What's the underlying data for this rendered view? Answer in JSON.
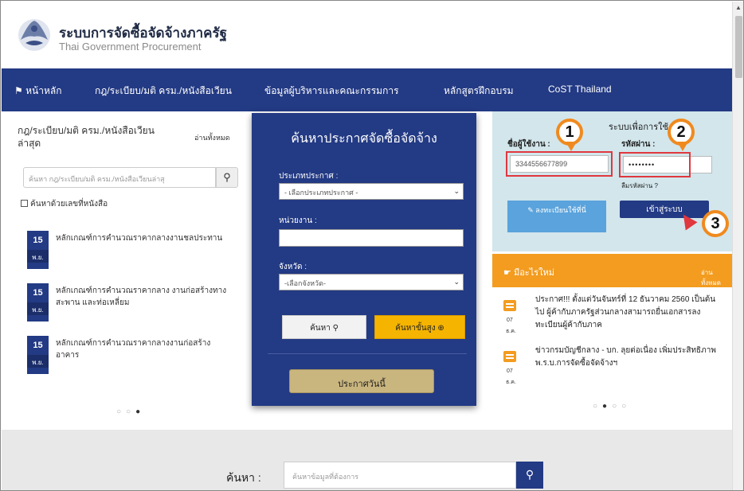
{
  "header": {
    "title": "ระบบการจัดซื้อจัดจ้างภาครัฐ",
    "subtitle": "Thai Government Procurement"
  },
  "nav": {
    "items": [
      {
        "label": "หน้าหลัก"
      },
      {
        "label": "กฎ/ระเบียบ/มติ ครม./หนังสือเวียน"
      },
      {
        "label": "ข้อมูลผู้บริหารและคณะกรรมการ"
      },
      {
        "label": "หลักสูตรฝึกอบรม"
      },
      {
        "label": "CoST Thailand"
      }
    ]
  },
  "left": {
    "title": "กฎ/ระเบียบ/มติ ครม./หนังสือเวียนล่าสุด",
    "read_all": "อ่านทั้งหมด",
    "search_placeholder": "ค้นหา กฎ/ระเบียบ/มติ ครม./หนังสือเวียนล่าสุ",
    "checkbox_label": "ค้นหาด้วยเลขที่หนังสือ",
    "items": [
      {
        "day": "15",
        "month": "พ.ย.",
        "text": "หลักเกณฑ์การคำนวณราคากลางงานชลประทาน"
      },
      {
        "day": "15",
        "month": "พ.ย.",
        "text": "หลักเกณฑ์การคำนวณราคากลาง งานก่อสร้างทาง สะพาน และท่อเหลี่ยม"
      },
      {
        "day": "15",
        "month": "พ.ย.",
        "text": "หลักเกณฑ์การคำนวณราคากลางงานก่อสร้างอาคาร"
      }
    ]
  },
  "center": {
    "title": "ค้นหาประกาศจัดซื้อจัดจ้าง",
    "type_label": "ประเภทประกาศ :",
    "type_value": "- เลือกประเภทประกาศ -",
    "agency_label": "หน่วยงาน :",
    "province_label": "จังหวัด :",
    "province_value": "-เลือกจังหวัด-",
    "search_button": "ค้นหา",
    "advanced_button": "ค้นหาขั้นสูง",
    "today_button": "ประกาศวันนี้"
  },
  "login": {
    "title": "ระบบเพื่อการใช้งาน",
    "username_label": "ชื่อผู้ใช้งาน :",
    "username_value": "3344556677899",
    "password_label": "รหัสผ่าน :",
    "password_value": "••••••••",
    "forgot": "ลืมรหัสผ่าน ?",
    "register_button": "ลงทะเบียนใช้ที่นี่",
    "login_button": "เข้าสู่ระบบ",
    "markers": [
      "1",
      "2",
      "3"
    ]
  },
  "whatsnew": {
    "title": "มีอะไรใหม่",
    "read_all": "อ่านทั้งหมด",
    "items": [
      {
        "day": "07",
        "month": "ธ.ค.",
        "text": "ประกาศ!!! ตั้งแต่วันจันทร์ที่ 12 ธันวาคม 2560 เป็นต้นไป ผู้ค้ากับภาครัฐส่วนกลางสามารถยื่นเอกสารลงทะเบียนผู้ค้ากับภาค"
      },
      {
        "day": "07",
        "month": "ธ.ค.",
        "text": "ข่าวกรมบัญชีกลาง - บก. ลุยต่อเนื่อง เพิ่มประสิทธิภาพ พ.ร.บ.การจัดซื้อจัดจ้างฯ"
      }
    ]
  },
  "bottom": {
    "label": "ค้นหา :",
    "placeholder": "ค้นหาข้อมูลที่ต้องการ"
  },
  "colors": {
    "navy": "#233a84",
    "orange": "#f39c1f",
    "login_bg": "#d2e6ec",
    "highlight_red": "#e0383e"
  }
}
